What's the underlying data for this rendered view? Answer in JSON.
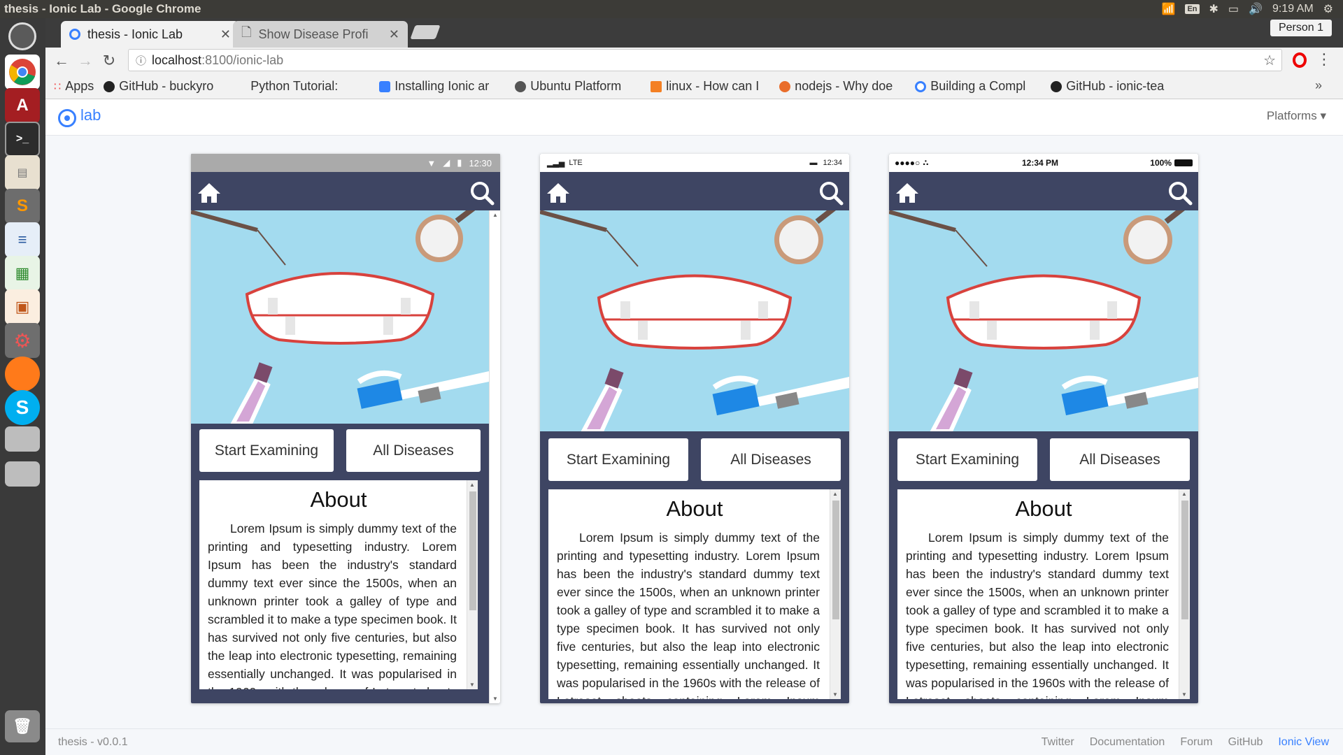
{
  "os": {
    "window_title": "thesis - Ionic Lab - Google Chrome",
    "keyboard_layout": "En",
    "clock": "9:19 AM",
    "launcher_icons": [
      "ubuntu-dash-icon",
      "chrome-icon",
      "software-center-icon",
      "terminal-icon",
      "files-icon",
      "sublime-text-icon",
      "writer-icon",
      "calc-icon",
      "impress-icon",
      "system-settings-icon",
      "firefox-icon",
      "skype-icon",
      "drive-icon",
      "drive-icon",
      "trash-icon"
    ]
  },
  "browser": {
    "tabs": [
      {
        "label": "thesis - Ionic Lab",
        "active": true
      },
      {
        "label": "Show Disease Profi",
        "active": false
      }
    ],
    "profile": "Person 1",
    "url_host": "localhost",
    "url_path": ":8100/ionic-lab",
    "bookmarks": [
      "Apps",
      "GitHub - buckyro",
      "Python Tutorial:",
      "Installing Ionic ar",
      "Ubuntu Platform",
      "linux - How can I",
      "nodejs - Why doe",
      "Building a Compl",
      "GitHub - ionic-tea"
    ],
    "bookmarks_overflow": "»"
  },
  "lab": {
    "logo_text": "lab",
    "platforms_label": "Platforms",
    "version": "thesis - v0.0.1",
    "footer_links": [
      "Twitter",
      "Documentation",
      "Forum",
      "GitHub",
      "Ionic View"
    ],
    "accent": "#3880ff"
  },
  "app": {
    "header_color": "#3e4563",
    "hero_color": "#a3dbef",
    "start_button": "Start Examining",
    "all_button": "All Diseases",
    "about_title": "About",
    "about_text": "Lorem Ipsum is simply dummy text of the printing and typesetting industry. Lorem Ipsum has been the industry's standard dummy text ever since the 1500s, when an unknown printer took a galley of type and scrambled it to make a type specimen book. It has survived not only five centuries, but also the leap into electronic typesetting, remaining essentially unchanged. It was popularised in the 1960s with the release of Letraset sheets containing Lorem Ipsum passages."
  },
  "devices": {
    "android": {
      "time": "12:30"
    },
    "windows": {
      "network": "LTE",
      "time": "12:34"
    },
    "ios": {
      "time": "12:34 PM",
      "battery": "100%"
    }
  }
}
